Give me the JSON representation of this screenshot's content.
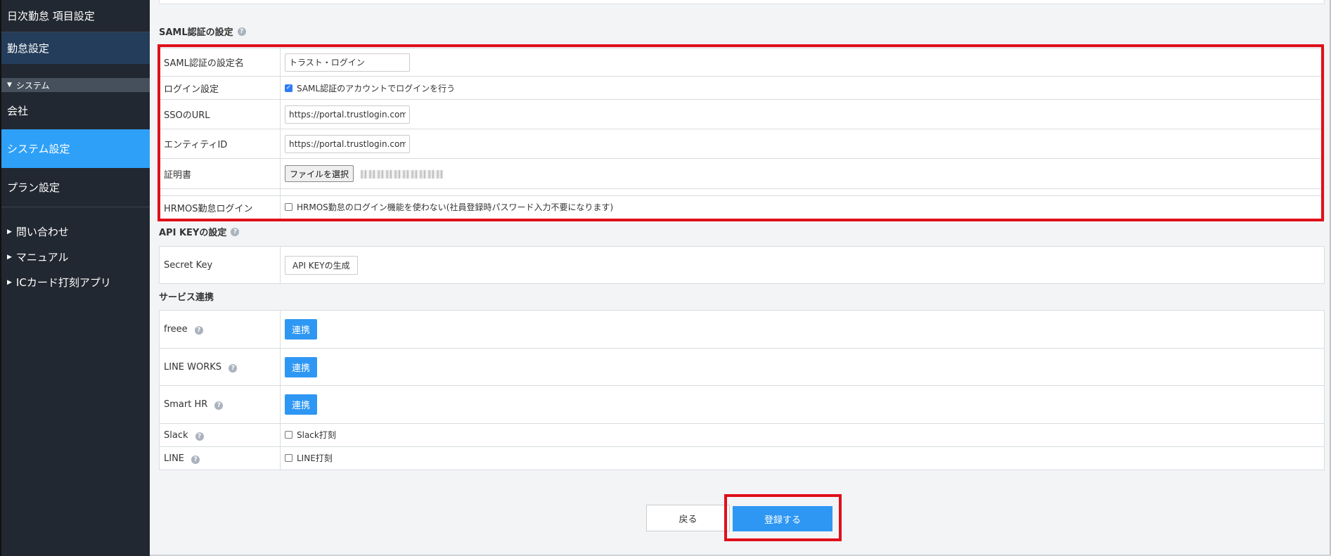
{
  "sidebar": {
    "item_top": "日次勤怠 項目設定",
    "item_attendance": "勤怠設定",
    "section_system": "システム",
    "item_company": "会社",
    "item_system_settings": "システム設定",
    "item_plan": "プラン設定",
    "link_contact": "問い合わせ",
    "link_manual": "マニュアル",
    "link_ic_app": "ICカード打刻アプリ"
  },
  "saml": {
    "title": "SAML認証の設定",
    "rows": {
      "name_label": "SAML認証の設定名",
      "name_value": "トラスト・ログイン",
      "login_label": "ログイン設定",
      "login_checkbox": "SAML認証のアカウントでログインを行う",
      "sso_label": "SSOのURL",
      "sso_value": "https://portal.trustlogin.com",
      "entity_label": "エンティティID",
      "entity_value": "https://portal.trustlogin.com",
      "cert_label": "証明書",
      "cert_button": "ファイルを選択",
      "hrmos_label": "HRMOS勤怠ログイン",
      "hrmos_checkbox": "HRMOS勤怠のログイン機能を使わない(社員登録時パスワード入力不要になります)"
    }
  },
  "api_key": {
    "title": "API KEYの設定",
    "secret_label": "Secret Key",
    "generate_button": "API KEYの生成"
  },
  "services": {
    "title": "サービス連携",
    "freee_label": "freee",
    "lineworks_label": "LINE WORKS",
    "smarthr_label": "Smart HR",
    "slack_label": "Slack",
    "slack_checkbox": "Slack打刻",
    "line_label": "LINE",
    "line_checkbox": "LINE打刻",
    "connect_button": "連携"
  },
  "footer": {
    "back_button": "戻る",
    "submit_button": "登録する"
  },
  "colors": {
    "sidebar_bg": "#222831",
    "active_item": "#2ea0f8",
    "primary_button": "#2e97f3",
    "annotation_red": "#e0101a"
  }
}
